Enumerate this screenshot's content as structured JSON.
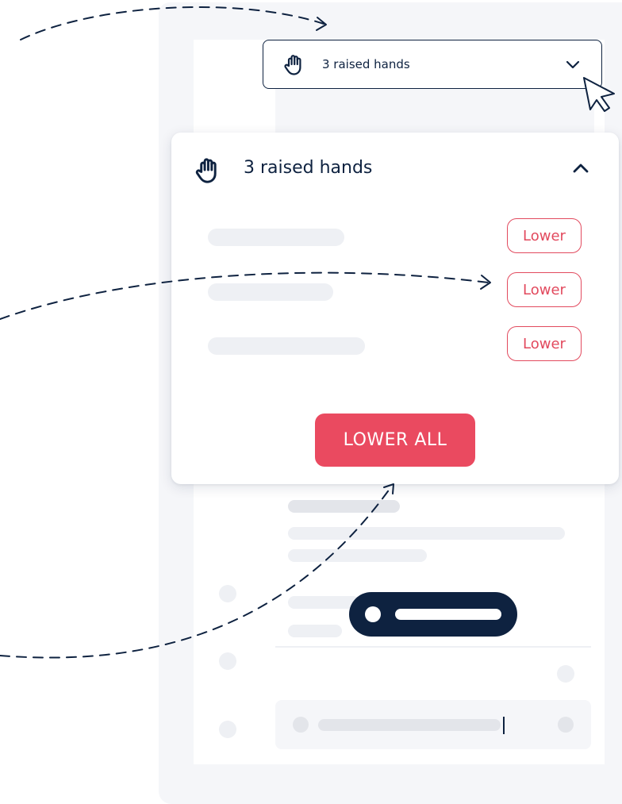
{
  "dropdown": {
    "label": "3 raised hands",
    "icon": "raised-hand-icon",
    "chevron": "chevron-down-icon"
  },
  "panel": {
    "title": "3 raised hands",
    "icon": "raised-hand-icon",
    "chevron": "chevron-up-icon",
    "rows": [
      {
        "lower_label": "Lower"
      },
      {
        "lower_label": "Lower"
      },
      {
        "lower_label": "Lower"
      }
    ],
    "lower_all_label": "LOWER ALL"
  },
  "colors": {
    "navy": "#0e2240",
    "accent_red": "#ea4a60",
    "outline_red": "#e24a5e",
    "skeleton": "#e3e5ea",
    "frame_bg": "#f5f6f9"
  }
}
